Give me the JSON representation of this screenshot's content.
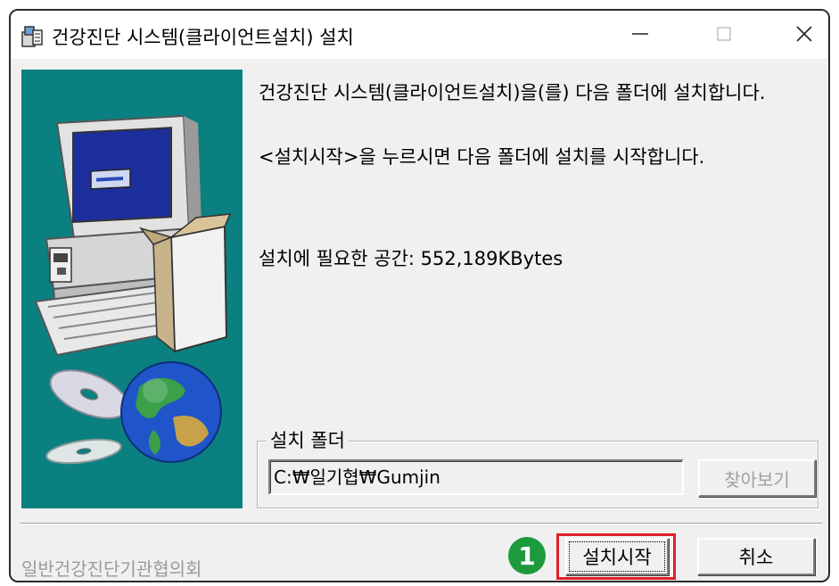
{
  "window": {
    "title": "건강진단 시스템(클라이언트설치) 설치",
    "controls": {
      "minimize": "—",
      "maximize": "☐",
      "close": "✕"
    }
  },
  "messages": {
    "line1": "건강진단 시스템(클라이언트설치)을(를) 다음 폴더에 설치합니다.",
    "line2": "<설치시작>을 누르시면 다음 폴더에 설치를 시작합니다.",
    "space_required": "설치에 필요한 공간: 552,189KBytes"
  },
  "install_folder": {
    "legend": "설치 폴더",
    "path": "C:₩일기협₩Gumjin",
    "browse_label": "찾아보기"
  },
  "footer": {
    "organization": "일반건강진단기관협의회"
  },
  "buttons": {
    "install": "설치시작",
    "cancel": "취소"
  },
  "annotation": {
    "step_number": "1",
    "badge_color": "#1c9a3c",
    "highlight_color": "#e01f2a"
  },
  "colors": {
    "side_panel": "#0b8080"
  }
}
